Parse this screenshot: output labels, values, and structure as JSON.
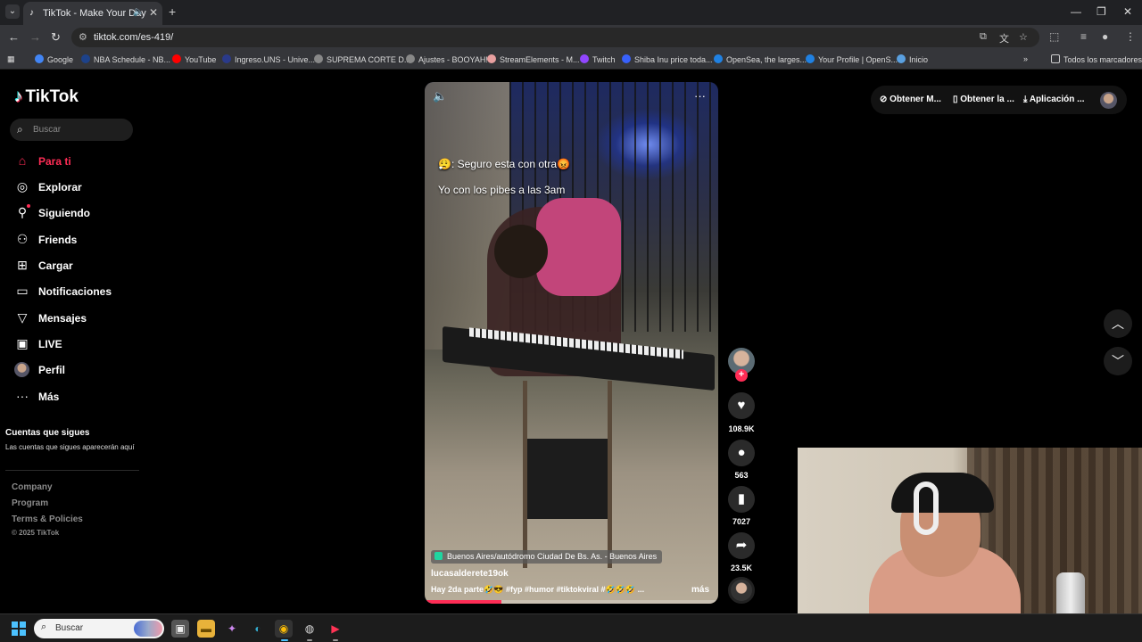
{
  "browser": {
    "tab_title": "TikTok - Make Your Day",
    "url": "tiktok.com/es-419/",
    "bookmarks": [
      {
        "label": "Google",
        "color": "#4285f4"
      },
      {
        "label": "NBA Schedule - NB...",
        "color": "#1d428a"
      },
      {
        "label": "YouTube",
        "color": "#ff0000"
      },
      {
        "label": "Ingreso.UNS - Unive...",
        "color": "#2a3a8a"
      },
      {
        "label": "SUPREMA CORTE D...",
        "color": "#888888"
      },
      {
        "label": "Ajustes - BOOYAH!",
        "color": "#888888"
      },
      {
        "label": "StreamElements - M...",
        "color": "#e8a0a0"
      },
      {
        "label": "Twitch",
        "color": "#9146ff"
      },
      {
        "label": "Shiba Inu price toda...",
        "color": "#3861fb"
      },
      {
        "label": "OpenSea, the larges...",
        "color": "#2081e2"
      },
      {
        "label": "Your Profile | OpenS...",
        "color": "#2081e2"
      },
      {
        "label": "Inicio",
        "color": "#5aa0e0"
      }
    ],
    "all_bookmarks": "Todos los marcadores"
  },
  "tiktok": {
    "logo": "TikTok",
    "search_placeholder": "Buscar",
    "nav": [
      {
        "label": "Para ti",
        "icon": "home-icon"
      },
      {
        "label": "Explorar",
        "icon": "compass-icon"
      },
      {
        "label": "Siguiendo",
        "icon": "following-icon"
      },
      {
        "label": "Friends",
        "icon": "friends-icon"
      },
      {
        "label": "Cargar",
        "icon": "upload-icon"
      },
      {
        "label": "Notificaciones",
        "icon": "notifications-icon"
      },
      {
        "label": "Mensajes",
        "icon": "messages-icon"
      },
      {
        "label": "LIVE",
        "icon": "live-icon"
      },
      {
        "label": "Perfil",
        "icon": "avatar"
      },
      {
        "label": "Más",
        "icon": "more-icon"
      }
    ],
    "following_title": "Cuentas que sigues",
    "following_desc": "Las cuentas que sigues aparecerán aquí",
    "footer": [
      "Company",
      "Program",
      "Terms & Policies"
    ],
    "copyright": "© 2025 TikTok",
    "top_buttons": [
      "Obtener M...",
      "Obtener la ...",
      "Aplicación ..."
    ],
    "video": {
      "caption_line1": "😮‍💨: Seguro esta con otra😡",
      "caption_line2": "Yo con los pibes a las 3am",
      "location": "Buenos Aires/autódromo Ciudad De Bs. As. - Buenos Aires",
      "author": "lucasalderete19ok",
      "description": "Hay 2da parte🤣😎 #fyp #humor #tiktokviral #🤣🤣🤣 ...",
      "more": "más",
      "progress": 0.26
    },
    "actions": {
      "likes": "108.9K",
      "comments": "563",
      "saves": "7027",
      "shares": "23.5K"
    }
  },
  "taskbar": {
    "search_placeholder": "Buscar"
  },
  "colors": {
    "accent": "#fe2c55",
    "page_bg": "#000000"
  }
}
